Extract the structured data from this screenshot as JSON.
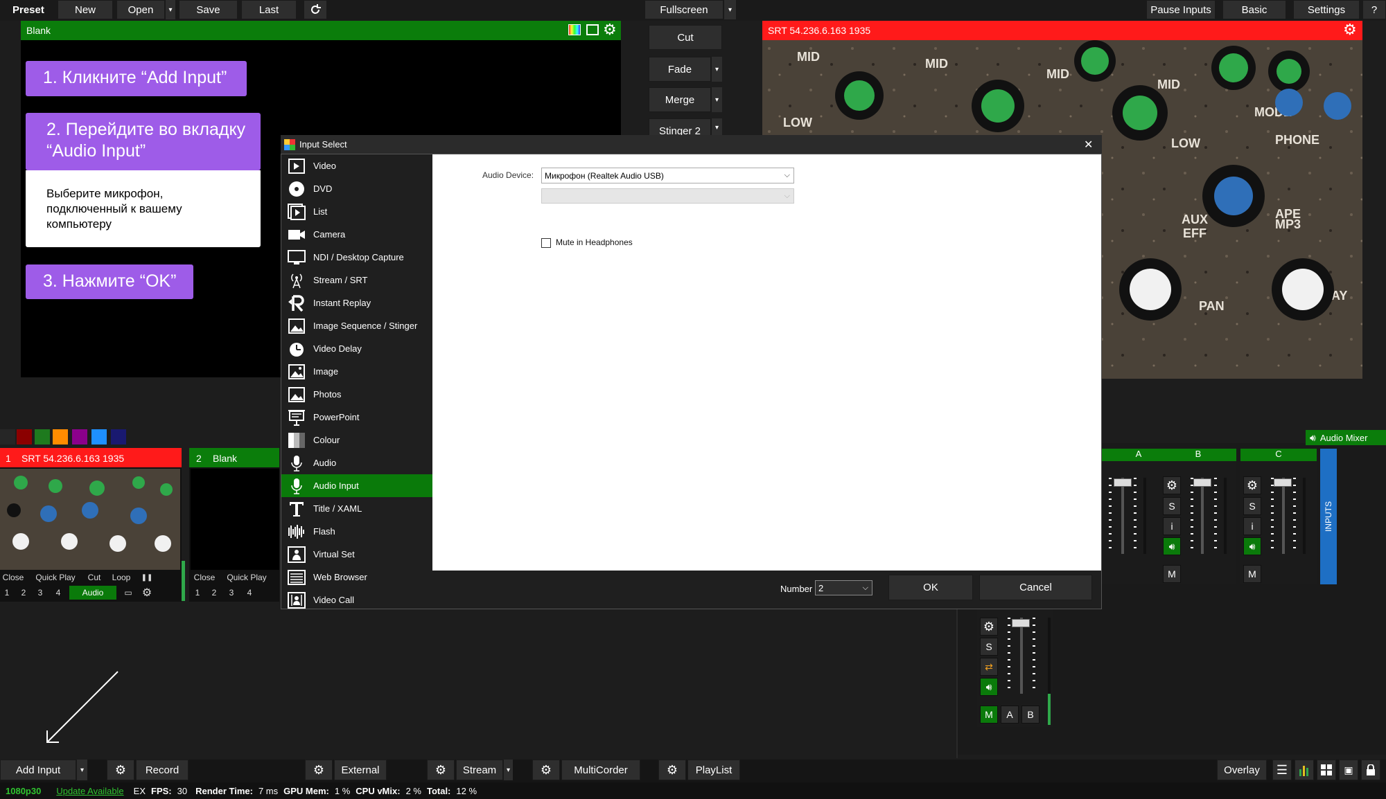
{
  "topbar": {
    "preset": "Preset",
    "new": "New",
    "open": "Open",
    "save": "Save",
    "last": "Last",
    "fullscreen": "Fullscreen",
    "pause_inputs": "Pause Inputs",
    "basic": "Basic",
    "settings": "Settings",
    "help": "?"
  },
  "preview": {
    "title": "Blank"
  },
  "output": {
    "title": "SRT 54.236.6.163 1935"
  },
  "transitions": [
    "Cut",
    "Fade",
    "Merge",
    "Stinger 2"
  ],
  "tutorial": {
    "step1": "1. Кликните “Add Input”",
    "step2": "2. Перейдите во вкладку “Audio Input”",
    "step2_note": "Выберите микрофон, подключенный к вашему компьютеру",
    "step3": "3. Нажмите “OK”"
  },
  "colors": {
    "palette": [
      "#262626",
      "#8b0000",
      "#1e7a1e",
      "#ff8c00",
      "#8b008b",
      "#1e90ff",
      "#191970"
    ],
    "accent_green": "#0a7a0a",
    "live_red": "#ff1a1a"
  },
  "inputs": [
    {
      "number": "1",
      "title": "SRT 54.236.6.163 1935",
      "buttons": [
        "Close",
        "Quick Play",
        "Cut",
        "Loop"
      ],
      "pause": "❚❚",
      "numbers": [
        "1",
        "2",
        "3",
        "4"
      ],
      "audio": "Audio"
    },
    {
      "number": "2",
      "title": "Blank",
      "buttons": [
        "Close",
        "Quick Play"
      ],
      "numbers": [
        "1",
        "2",
        "3",
        "4"
      ]
    }
  ],
  "dialog": {
    "title": "Input Select",
    "close": "✕",
    "categories": [
      {
        "label": "Video",
        "icon": "video-icon"
      },
      {
        "label": "DVD",
        "icon": "dvd-icon"
      },
      {
        "label": "List",
        "icon": "list-icon"
      },
      {
        "label": "Camera",
        "icon": "camera-icon"
      },
      {
        "label": "NDI / Desktop Capture",
        "icon": "monitor-icon"
      },
      {
        "label": "Stream / SRT",
        "icon": "antenna-icon"
      },
      {
        "label": "Instant Replay",
        "icon": "replay-icon"
      },
      {
        "label": "Image Sequence / Stinger",
        "icon": "image-sequence-icon"
      },
      {
        "label": "Video Delay",
        "icon": "timer-icon"
      },
      {
        "label": "Image",
        "icon": "image-icon"
      },
      {
        "label": "Photos",
        "icon": "photos-icon"
      },
      {
        "label": "PowerPoint",
        "icon": "presentation-icon"
      },
      {
        "label": "Colour",
        "icon": "colour-icon"
      },
      {
        "label": "Audio",
        "icon": "microphone-icon"
      },
      {
        "label": "Audio Input",
        "icon": "microphone-icon"
      },
      {
        "label": "Title / XAML",
        "icon": "title-icon"
      },
      {
        "label": "Flash",
        "icon": "flash-icon"
      },
      {
        "label": "Virtual Set",
        "icon": "virtual-set-icon"
      },
      {
        "label": "Web Browser",
        "icon": "browser-icon"
      },
      {
        "label": "Video Call",
        "icon": "video-call-icon"
      }
    ],
    "selected": "Audio Input",
    "audio_device_label": "Audio Device:",
    "audio_device_value": "Микрофон (Realtek Audio USB)",
    "second_select_value": "",
    "mute_label": "Mute in Headphones",
    "mute_checked": false,
    "number_label": "Number",
    "number_value": "2",
    "ok": "OK",
    "cancel": "Cancel"
  },
  "mixer": {
    "title": "Audio Mixer",
    "inputs_tab": "INPUTS",
    "buses": [
      "A",
      "B",
      "C"
    ],
    "s": "S",
    "i": "i",
    "m": "M",
    "a": "A",
    "b": "B"
  },
  "bottombar": {
    "add_input": "Add Input",
    "record": "Record",
    "external": "External",
    "stream": "Stream",
    "multicorder": "MultiCorder",
    "playlist": "PlayList",
    "overlay": "Overlay"
  },
  "status": {
    "resolution": "1080p30",
    "update": "Update Available",
    "ex": "EX",
    "fps_label": "FPS:",
    "fps": "30",
    "render_label": "Render Time:",
    "render": "7 ms",
    "gpu_label": "GPU Mem:",
    "gpu": "1 %",
    "cpu_label": "CPU vMix:",
    "cpu": "2 %",
    "total_label": "Total:",
    "total": "12 %"
  }
}
